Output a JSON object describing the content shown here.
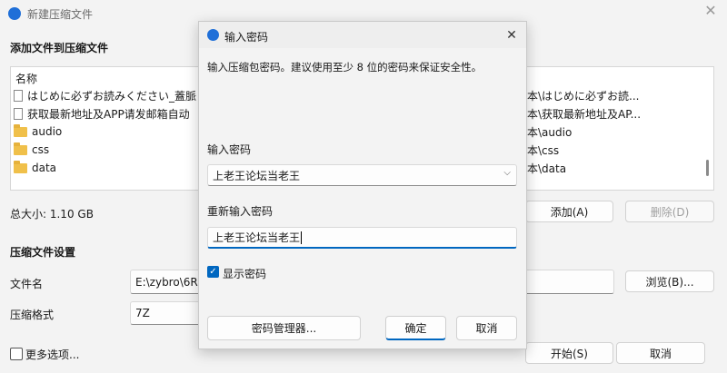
{
  "main_window": {
    "title": "新建压缩文件",
    "section_title": "添加文件到压缩文件",
    "column_name": "名称",
    "files": [
      {
        "icon": "file-icon",
        "name": "はじめに必ずお読みください_蓋脈"
      },
      {
        "icon": "file-icon",
        "name": "获取最新地址及APP请发邮箱自动"
      },
      {
        "icon": "folder-icon",
        "name": "audio"
      },
      {
        "icon": "folder-icon",
        "name": "css"
      },
      {
        "icon": "folder-icon",
        "name": "data"
      }
    ],
    "paths": [
      "本\\はじめに必ずお読...",
      "本\\获取最新地址及AP...",
      "本\\audio",
      "本\\css",
      "本\\data"
    ],
    "total_size": "总大小: 1.10 GB",
    "add_button": "添加(A)",
    "delete_button": "删除(D)",
    "settings_title": "压缩文件设置",
    "filename_label": "文件名",
    "filename_value": "E:\\zybro\\6R.",
    "browse_button": "浏览(B)...",
    "format_label": "压缩格式",
    "format_value": "7Z",
    "more_options": "更多选项...",
    "start_button": "开始(S)",
    "cancel_button": "取消"
  },
  "dialog": {
    "title": "输入密码",
    "description": "输入压缩包密码。建议使用至少 8 位的密码来保证安全性。",
    "password_label": "输入密码",
    "password_value": "上老王论坛当老王",
    "repeat_label": "重新输入密码",
    "repeat_value": "上老王论坛当老王",
    "show_password": "显示密码",
    "show_password_checked": true,
    "manager_button": "密码管理器...",
    "ok_button": "确定",
    "cancel_button": "取消"
  },
  "colors": {
    "accent": "#0067c0",
    "app_icon": "#1f6fd8"
  }
}
